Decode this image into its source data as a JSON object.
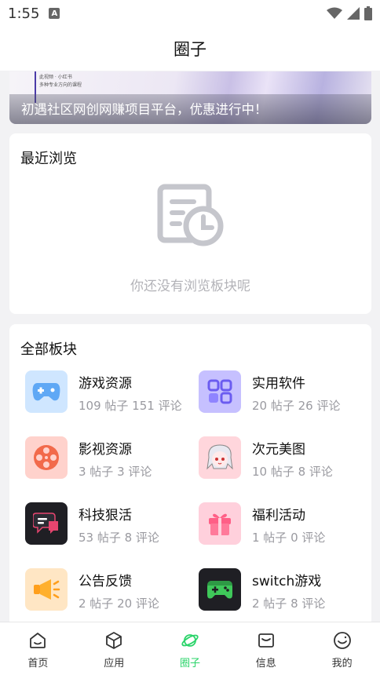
{
  "status": {
    "time": "1:55",
    "notif_letter": "A"
  },
  "header": {
    "title": "圈子"
  },
  "banner": {
    "caption": "初遇社区网创网赚项目平台，优惠进行中！",
    "tiny_line1": "此视频 · 小红书",
    "tiny_line2": "多种专业方向的课程"
  },
  "recent": {
    "title": "最近浏览",
    "empty_text": "你还没有浏览板块呢"
  },
  "all_boards": {
    "title": "全部板块",
    "items": [
      {
        "name": "游戏资源",
        "stats": "109 帖子 151 评论",
        "icon": "gamepad-icon",
        "color": "#cfe6ff"
      },
      {
        "name": "实用软件",
        "stats": "20 帖子 26 评论",
        "icon": "apps-grid-icon",
        "color": "#c6c0ff"
      },
      {
        "name": "影视资源",
        "stats": "3 帖子 3 评论",
        "icon": "film-reel-icon",
        "color": "#ffd2cc"
      },
      {
        "name": "次元美图",
        "stats": "10 帖子 8 评论",
        "icon": "anime-girl-icon",
        "color": "#ffd6dc"
      },
      {
        "name": "科技狠活",
        "stats": "53 帖子 8 评论",
        "icon": "chat-bubble-icon",
        "color": "#1f1f24"
      },
      {
        "name": "福利活动",
        "stats": "1 帖子 0 评论",
        "icon": "gift-icon",
        "color": "#ffd0dc"
      },
      {
        "name": "公告反馈",
        "stats": "2 帖子 20 评论",
        "icon": "megaphone-icon",
        "color": "#ffe6c4"
      },
      {
        "name": "switch游戏",
        "stats": "2 帖子 8 评论",
        "icon": "game-controller-icon",
        "color": "#1f1f24"
      }
    ]
  },
  "tabbar": {
    "items": [
      {
        "label": "首页",
        "icon": "home-icon"
      },
      {
        "label": "应用",
        "icon": "cube-icon"
      },
      {
        "label": "圈子",
        "icon": "planet-icon",
        "active": true
      },
      {
        "label": "信息",
        "icon": "message-icon"
      },
      {
        "label": "我的",
        "icon": "smile-icon"
      }
    ],
    "active_color": "#2bd46a"
  }
}
